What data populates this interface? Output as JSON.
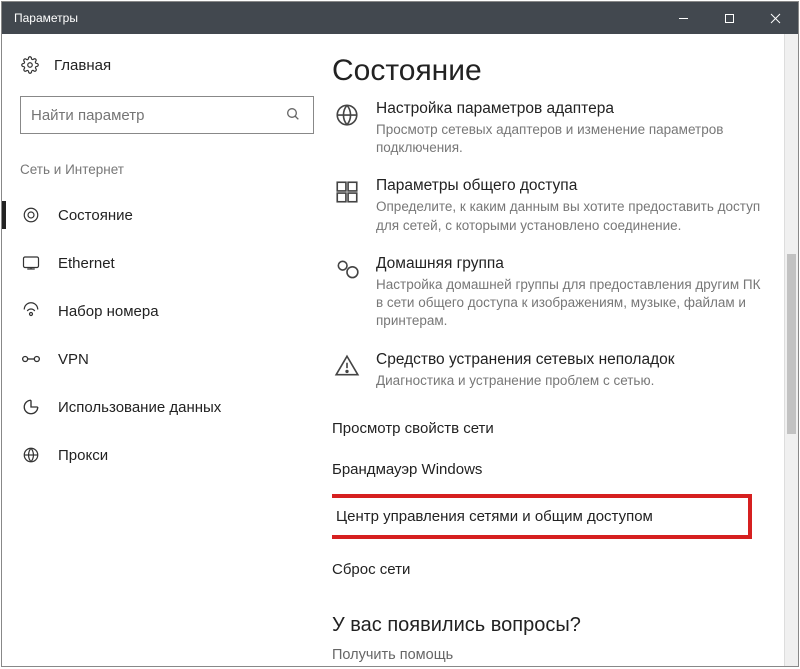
{
  "window": {
    "title": "Параметры"
  },
  "sidebar": {
    "home": "Главная",
    "search_placeholder": "Найти параметр",
    "section_label": "Сеть и Интернет",
    "items": [
      {
        "label": "Состояние",
        "icon": "status"
      },
      {
        "label": "Ethernet",
        "icon": "ethernet"
      },
      {
        "label": "Набор номера",
        "icon": "dialup"
      },
      {
        "label": "VPN",
        "icon": "vpn"
      },
      {
        "label": "Использование данных",
        "icon": "datausage"
      },
      {
        "label": "Прокси",
        "icon": "proxy"
      }
    ]
  },
  "main": {
    "heading": "Состояние",
    "options": [
      {
        "title": "Настройка параметров адаптера",
        "desc": "Просмотр сетевых адаптеров и изменение параметров подключения."
      },
      {
        "title": "Параметры общего доступа",
        "desc": "Определите, к каким данным вы хотите предоставить доступ для сетей, с которыми установлено соединение."
      },
      {
        "title": "Домашняя группа",
        "desc": "Настройка домашней группы для предоставления другим ПК в сети общего доступа к изображениям, музыке, файлам и принтерам."
      },
      {
        "title": "Средство устранения сетевых неполадок",
        "desc": "Диагностика и устранение проблем с сетью."
      }
    ],
    "links": {
      "view_properties": "Просмотр свойств сети",
      "firewall": "Брандмауэр Windows",
      "sharing_center": "Центр управления сетями и общим доступом",
      "reset": "Сброс сети"
    },
    "questions_heading": "У вас появились вопросы?",
    "help": "Получить помощь"
  }
}
